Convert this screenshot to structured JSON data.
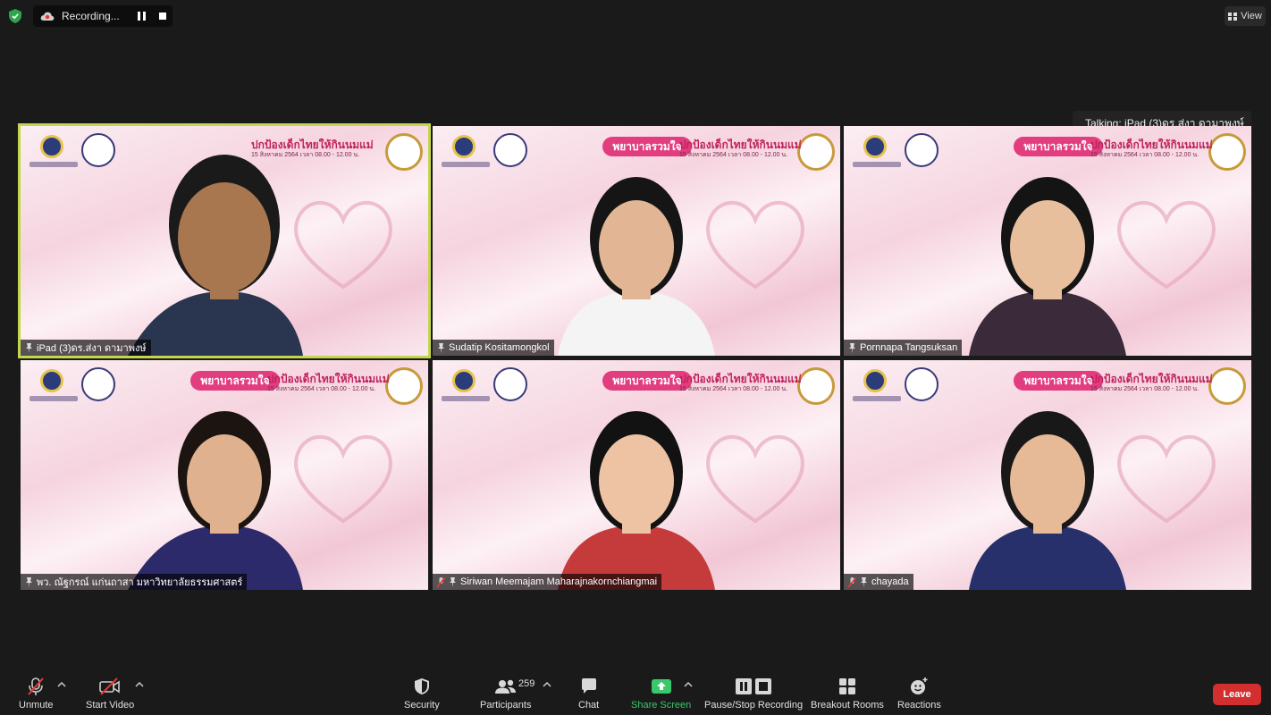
{
  "topbar": {
    "recording_label": "Recording...",
    "view_label": "View"
  },
  "talking_indicator": "Talking: iPad (3)ดร.ส่งา ดามาพงษ์",
  "tiles": [
    {
      "name": "iPad (3)ดร.ส่งา ดามาพงษ์",
      "active": true,
      "muted": false
    },
    {
      "name": "Sudatip Kositamongkol",
      "active": false,
      "muted": false
    },
    {
      "name": "Pornnapa Tangsuksan",
      "active": false,
      "muted": false
    },
    {
      "name": "พว. ณัฐกรณ์ แก่นถาสา  มหาวิทยาลัยธรรมศาสตร์",
      "active": false,
      "muted": false
    },
    {
      "name": "Siriwan Meemajam Maharajnakornchiangmai",
      "active": false,
      "muted": true
    },
    {
      "name": "chayada",
      "active": false,
      "muted": true
    }
  ],
  "slide": {
    "banner": "พยาบาลรวมใจ",
    "headline": "ปกป้องเด็กไทยให้กินนมแม่",
    "subline": "15 สิงหาคม 2564 เวลา 08.00 - 12.00 น."
  },
  "toolbar": {
    "unmute": "Unmute",
    "start_video": "Start Video",
    "security": "Security",
    "participants": "Participants",
    "participants_count": "259",
    "chat": "Chat",
    "share_screen": "Share Screen",
    "pause_stop": "Pause/Stop Recording",
    "breakout": "Breakout Rooms",
    "reactions": "Reactions",
    "leave": "Leave"
  },
  "colors": {
    "active_speaker_border": "#c2d64e",
    "share_green": "#3ac86b",
    "leave_red": "#d32f2f",
    "banner_pink": "#e23d7f"
  }
}
